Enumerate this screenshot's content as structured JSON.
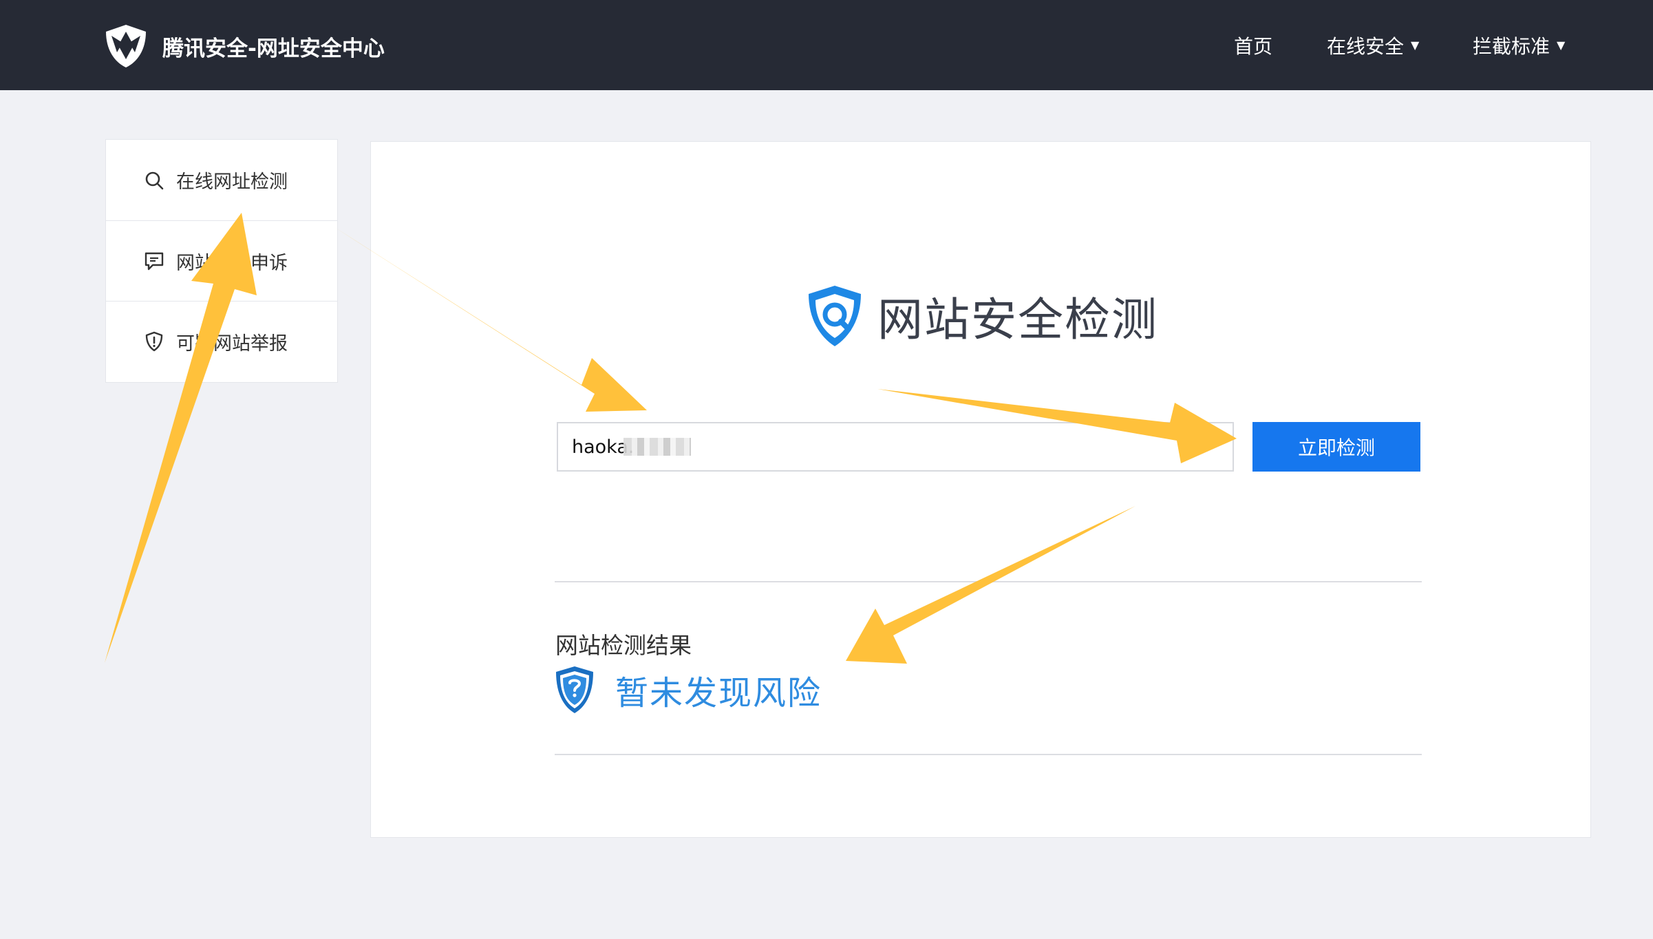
{
  "header": {
    "brand_title": "腾讯安全-网址安全中心",
    "brand_logo_icon": "tencent-security-shield-logo",
    "nav": {
      "home": "首页",
      "online_security": "在线安全",
      "block_standard": "拦截标准",
      "dropdown_icon": "caret-down-icon"
    }
  },
  "sidebar": {
    "items": [
      {
        "label": "在线网址检测",
        "icon": "search-icon"
      },
      {
        "label": "网站误报申诉",
        "icon": "chat-icon"
      },
      {
        "label": "可疑网站举报",
        "icon": "shield-alert-icon"
      }
    ]
  },
  "main": {
    "title": "网站安全检测",
    "title_icon": "shield-search-icon",
    "url_value": "haoka.",
    "check_button": "立即检测",
    "result_title": "网站检测结果",
    "result_icon": "blue-shield-icon",
    "result_text": "暂未发现风险"
  },
  "colors": {
    "header_bg": "#262a35",
    "page_bg": "#f0f1f5",
    "accent": "#1677ee",
    "result_text": "#2f8ce0",
    "annotation_arrow": "#ffc13b"
  }
}
